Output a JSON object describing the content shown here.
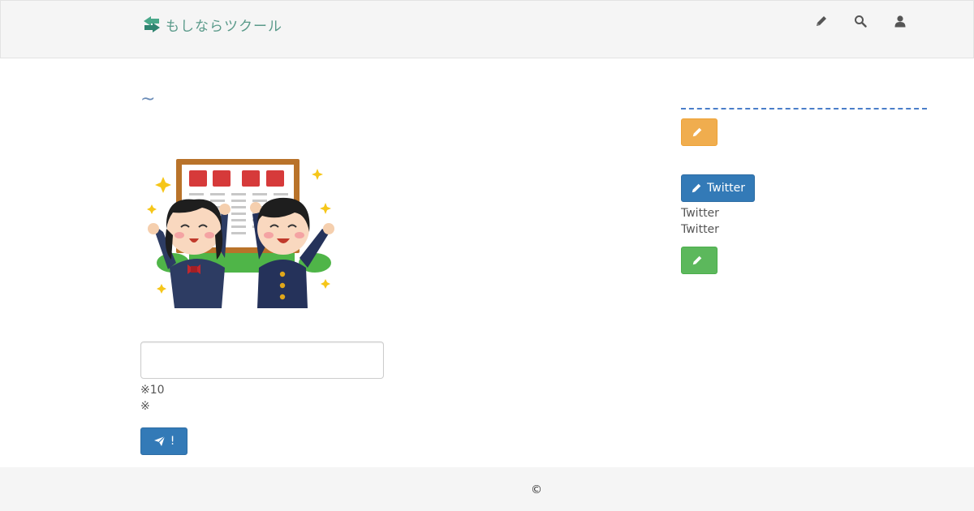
{
  "header": {
    "brand_label": "もしならツクール",
    "nav_icons": [
      "pencil-icon",
      "search-icon",
      "user-icon"
    ]
  },
  "main": {
    "heading": "~",
    "illustration_icon": "celebration-illustration",
    "input": {
      "value": "",
      "placeholder": ""
    },
    "notes": [
      "※10",
      "※"
    ],
    "submit_label": "!"
  },
  "sidebar": {
    "edit_button_label": "",
    "twitter_button_label": "Twitter",
    "twitter_lines": [
      "Twitter",
      "Twitter"
    ],
    "green_button_label": ""
  },
  "footer": {
    "copyright": "©"
  },
  "colors": {
    "brand": "#5a9a8a",
    "primary": "#337ab7",
    "warning": "#f0ad4e",
    "success": "#5cb85c",
    "dashed_line": "#4a7ec9"
  }
}
